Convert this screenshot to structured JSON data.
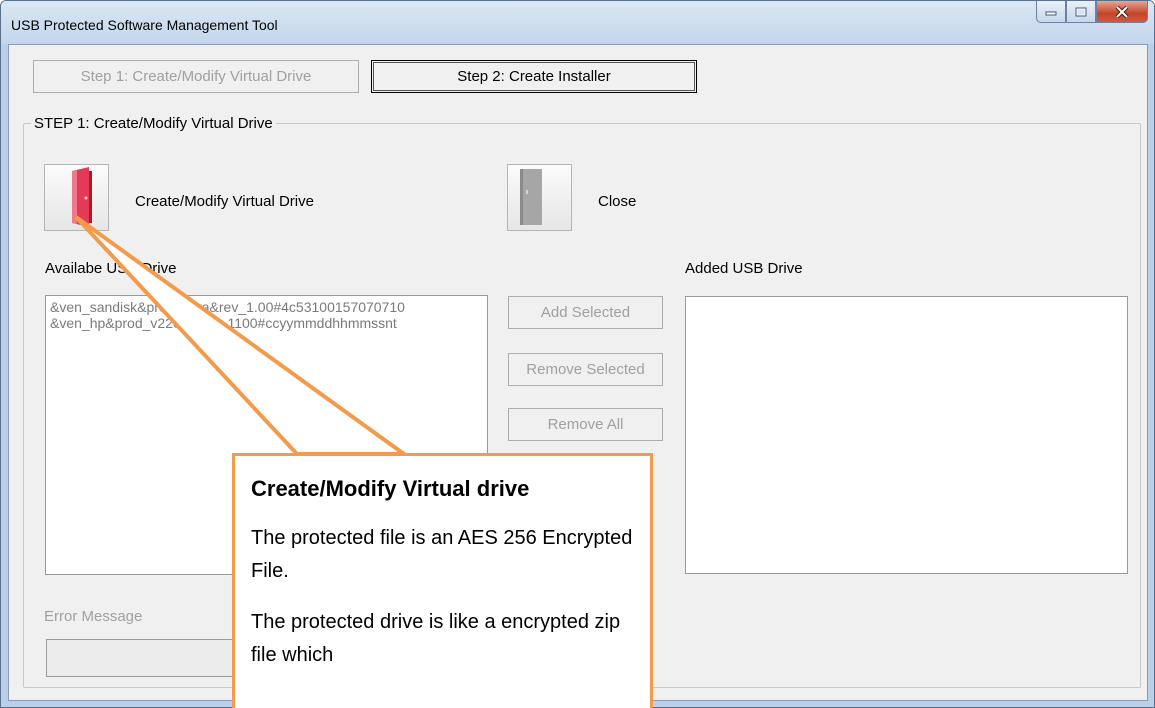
{
  "window": {
    "title": "USB Protected Software Management Tool"
  },
  "toolbar": {
    "step1_label": "Step 1: Create/Modify Virtual Drive",
    "step2_label": "Step 2: Create Installer"
  },
  "group": {
    "label": "STEP 1: Create/Modify Virtual Drive"
  },
  "actions": {
    "create_label": "Create/Modify Virtual Drive",
    "close_label": "Close"
  },
  "available": {
    "label": "Availabe USB Drive",
    "items": [
      "&ven_sandisk&prod_ultra&rev_1.00#4c53100157070710",
      "&ven_hp&prod_v220w&rev_1100#ccyymmddhhmmssnt"
    ]
  },
  "added": {
    "label": "Added USB Drive"
  },
  "buttons": {
    "add_selected": "Add Selected",
    "remove_selected": "Remove Selected",
    "remove_all": "Remove All"
  },
  "error": {
    "label": "Error Message"
  },
  "callout": {
    "title": "Create/Modify Virtual drive",
    "para1": "The protected file is an AES 256 Encrypted File.",
    "para2": "The protected drive  is like a encrypted zip file which"
  },
  "colors": {
    "accent_orange": "#f39b4c",
    "door_red": "#d9263f",
    "door_gray": "#9a9a9a"
  }
}
